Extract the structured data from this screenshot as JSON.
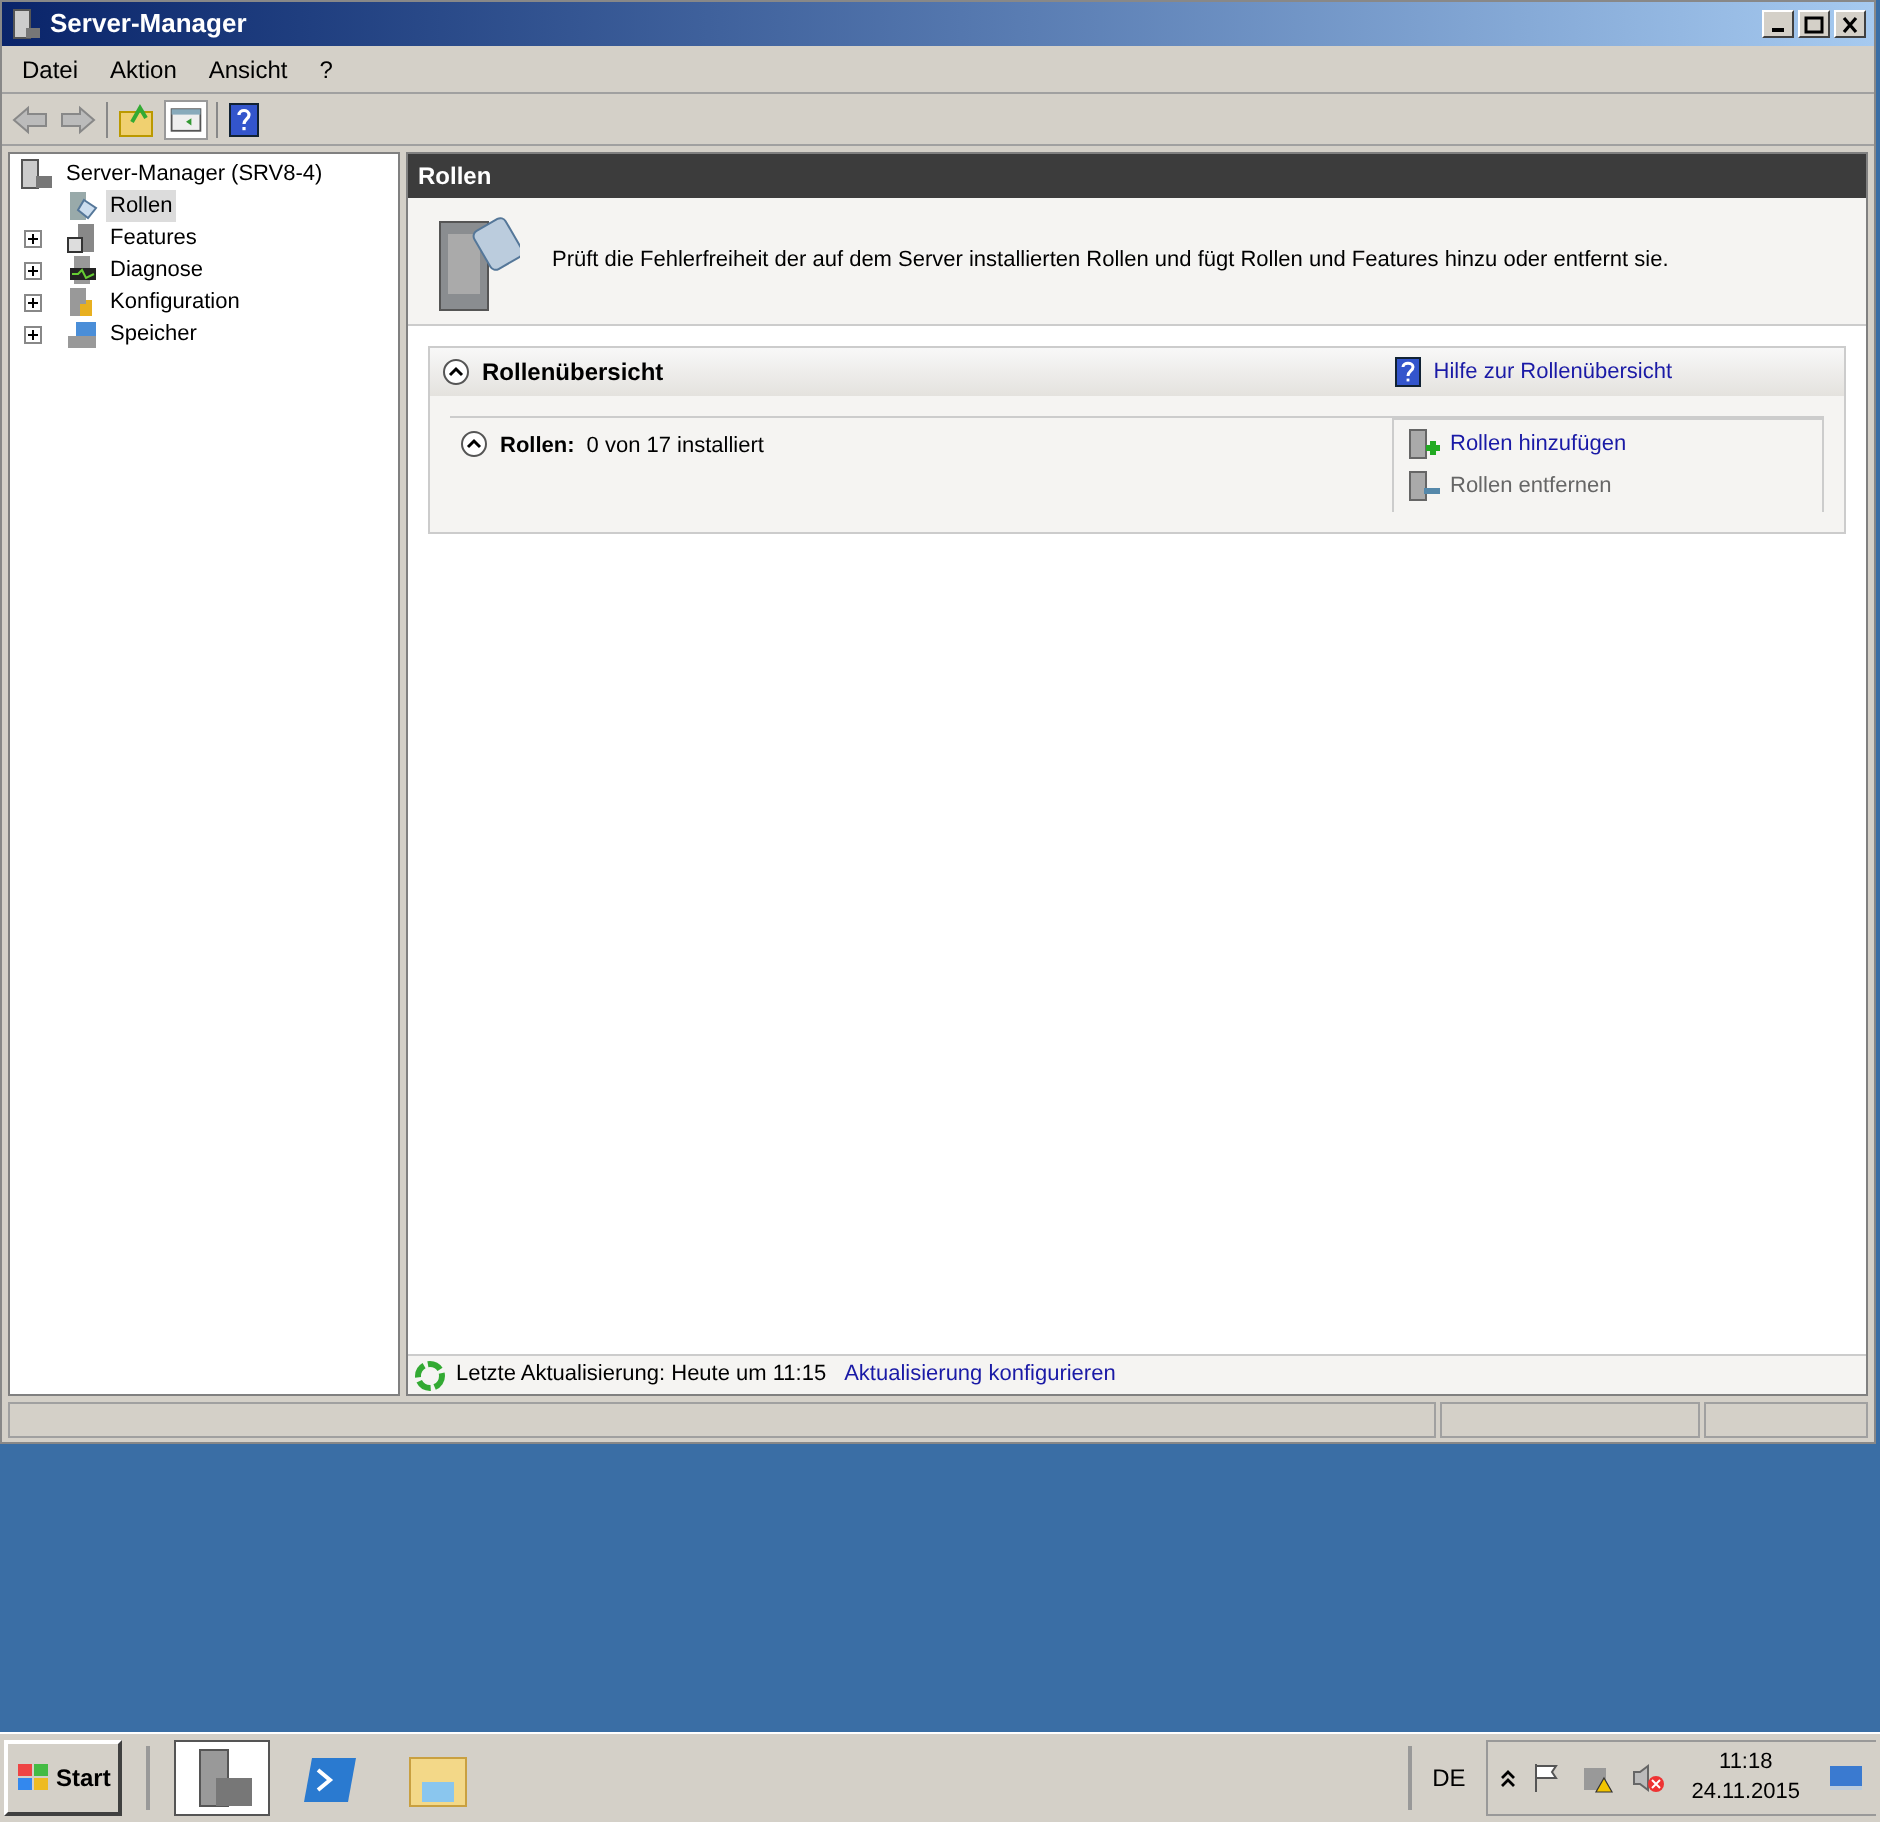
{
  "window": {
    "title": "Server-Manager"
  },
  "menu": [
    "Datei",
    "Aktion",
    "Ansicht",
    "?"
  ],
  "tree": {
    "label": "Server-Manager (SRV8-4)",
    "selected": false,
    "children": [
      {
        "label": "Rollen",
        "kind": "roles",
        "selected": true
      },
      {
        "label": "Features",
        "kind": "features",
        "selected": false,
        "expanded": false
      },
      {
        "label": "Diagnose",
        "kind": "diagnose",
        "selected": false,
        "expanded": false
      },
      {
        "label": "Konfiguration",
        "kind": "config",
        "selected": false,
        "expanded": false
      },
      {
        "label": "Speicher",
        "kind": "storage",
        "selected": false,
        "expanded": false
      }
    ]
  },
  "content": {
    "header": "Rollen",
    "description": "Prüft die Fehlerfreiheit der auf dem Server installierten Rollen und fügt Rollen und Features hinzu oder entfernt sie.",
    "section": {
      "title": "Rollenübersicht",
      "expanded": true,
      "help_link": "Hilfe zur Rollenübersicht",
      "subsection": {
        "label": "Rollen:",
        "value": "0 von 17 installiert",
        "expanded": true,
        "actions": [
          {
            "label": "Rollen hinzufügen",
            "disabled": false,
            "kind": "add"
          },
          {
            "label": "Rollen entfernen",
            "disabled": true,
            "kind": "remove"
          }
        ]
      }
    }
  },
  "footer": {
    "text": "Letzte Aktualisierung: Heute um 11:15",
    "link": "Aktualisierung konfigurieren"
  },
  "taskbar": {
    "start": "Start",
    "apps": [
      {
        "kind": "server",
        "selected": true
      },
      {
        "kind": "shell",
        "selected": false
      },
      {
        "kind": "folder",
        "selected": false
      }
    ],
    "language": "DE",
    "time": "11:18",
    "date": "24.11.2015"
  }
}
